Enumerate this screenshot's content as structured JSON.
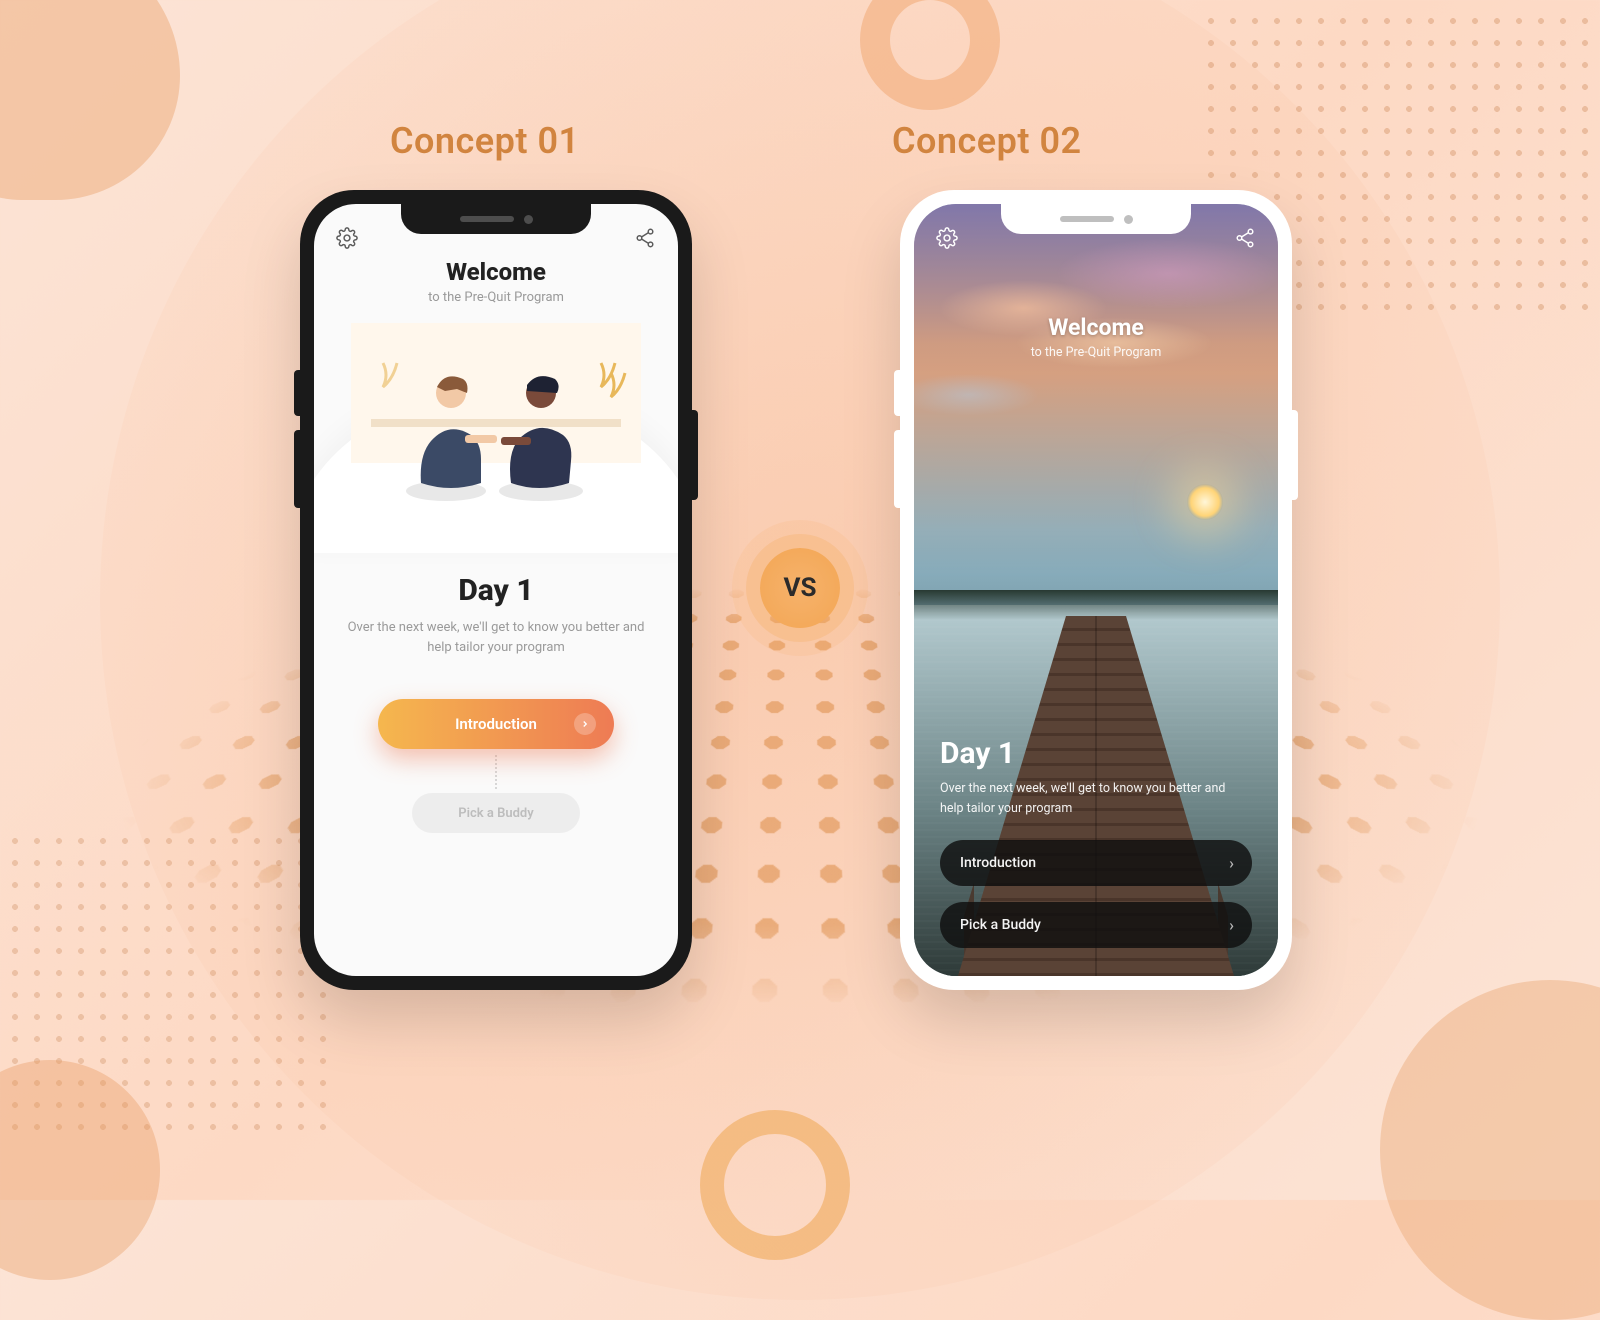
{
  "labels": {
    "concept1": "Concept 01",
    "concept2": "Concept 02",
    "vs": "VS"
  },
  "concept1": {
    "topbar": {
      "left_icon": "gear-icon",
      "right_icon": "share-icon"
    },
    "welcome_title": "Welcome",
    "welcome_subtitle": "to the Pre-Quit Program",
    "day_title": "Day 1",
    "day_desc": "Over the next week, we'll get to know you better and help tailor your program",
    "primary_button": "Introduction",
    "secondary_button": "Pick a Buddy"
  },
  "concept2": {
    "topbar": {
      "left_icon": "gear-icon",
      "right_icon": "share-icon"
    },
    "welcome_title": "Welcome",
    "welcome_subtitle": "to the Pre-Quit Program",
    "day_title": "Day 1",
    "day_desc": "Over the next week, we'll get to know you better and help tailor your program",
    "button1": "Introduction",
    "button2": "Pick a Buddy"
  },
  "colors": {
    "accent_orange": "#d1843f",
    "gradient_from": "#f5b74e",
    "gradient_to": "#ee7b54"
  }
}
